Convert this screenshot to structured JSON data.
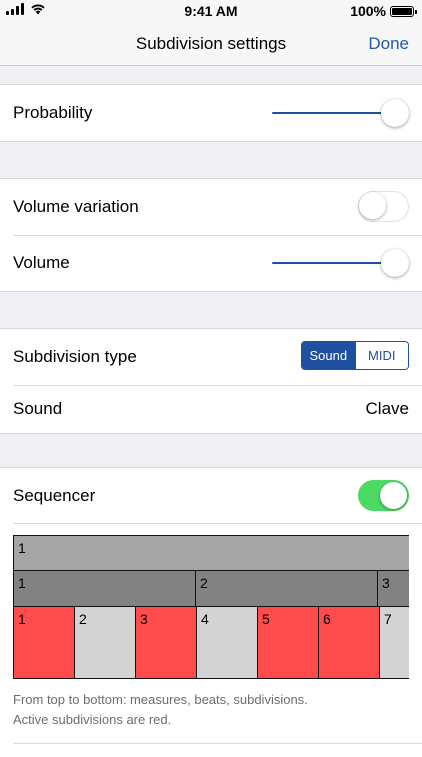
{
  "status_bar": {
    "time": "9:41 AM",
    "battery": "100%",
    "icons": [
      "cellular-signal-icon",
      "wifi-icon",
      "battery-icon"
    ]
  },
  "nav": {
    "title": "Subdivision settings",
    "done": "Done"
  },
  "groups": {
    "probability": {
      "label": "Probability",
      "value": 1.0
    },
    "volume": {
      "variation_label": "Volume variation",
      "variation_on": false,
      "volume_label": "Volume",
      "volume_value": 1.0
    },
    "subdivision": {
      "type_label": "Subdivision type",
      "type_options": [
        "Sound",
        "MIDI"
      ],
      "type_selected": "Sound",
      "sound_label": "Sound",
      "sound_value": "Clave"
    },
    "sequencer": {
      "label": "Sequencer",
      "on": true
    }
  },
  "sequencer_grid": {
    "measures": [
      {
        "label": "1"
      }
    ],
    "beats": [
      {
        "label": "1"
      },
      {
        "label": "2"
      },
      {
        "label": "3"
      }
    ],
    "subdivisions": [
      {
        "label": "1",
        "active": true
      },
      {
        "label": "2",
        "active": false
      },
      {
        "label": "3",
        "active": true
      },
      {
        "label": "4",
        "active": false
      },
      {
        "label": "5",
        "active": true
      },
      {
        "label": "6",
        "active": true
      },
      {
        "label": "7",
        "active": false
      }
    ]
  },
  "footer": {
    "line1": "From top to bottom: measures, beats, subdivisions.",
    "line2": "Active subdivisions are red."
  },
  "colors": {
    "accent": "#1f4fa0",
    "toggle_on": "#4cd964",
    "active_subdivision": "#fe4b4b",
    "inactive_subdivision": "#d3d3d3",
    "beat": "#828282",
    "measure": "#a5a5a5"
  }
}
